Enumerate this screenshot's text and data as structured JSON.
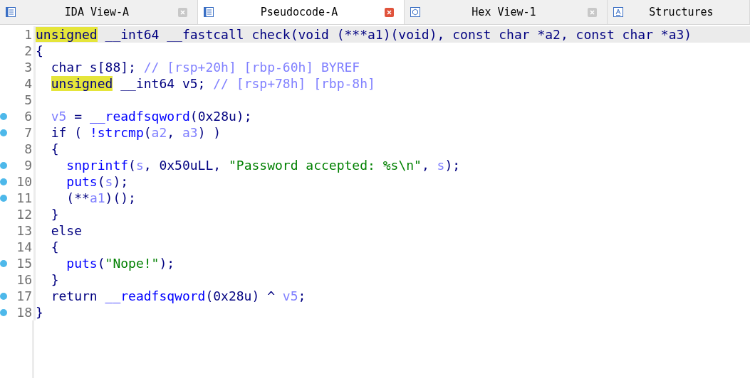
{
  "tabs": [
    {
      "label": "IDA View-A",
      "selected": false,
      "closable": true
    },
    {
      "label": "Pseudocode-A",
      "selected": true,
      "closable": true
    },
    {
      "label": "Hex View-1",
      "selected": false,
      "closable": true
    },
    {
      "label": "Structures",
      "selected": false,
      "closable": false
    }
  ],
  "code": [
    {
      "number": "1",
      "dot": false,
      "current": true,
      "tokens": [
        {
          "kind": "hl",
          "text": "unsigned"
        },
        {
          "kind": "text",
          "text": " __int64 __fastcall check(void (***a1)(void), const char *a2, const char *a3)"
        }
      ]
    },
    {
      "number": "2",
      "dot": false,
      "current": false,
      "tokens": [
        {
          "kind": "text",
          "text": "{"
        }
      ]
    },
    {
      "number": "3",
      "dot": false,
      "current": false,
      "tokens": [
        {
          "kind": "text",
          "text": "  char s[88]; "
        },
        {
          "kind": "comment",
          "text": "// [rsp+20h] [rbp-60h] BYREF"
        }
      ]
    },
    {
      "number": "4",
      "dot": false,
      "current": false,
      "tokens": [
        {
          "kind": "hl",
          "text": "  unsigned"
        },
        {
          "kind": "text",
          "text": " __int64 v5; "
        },
        {
          "kind": "comment",
          "text": "// [rsp+78h] [rbp-8h]"
        }
      ]
    },
    {
      "number": "5",
      "dot": false,
      "current": false
    },
    {
      "number": "6",
      "dot": true,
      "current": false,
      "tokens": [
        {
          "kind": "var",
          "text": "  v5"
        },
        {
          "kind": "text",
          "text": " = "
        },
        {
          "kind": "func",
          "text": "__readfsqword"
        },
        {
          "kind": "text",
          "text": "(0x28u);"
        }
      ]
    },
    {
      "number": "7",
      "dot": true,
      "current": false,
      "tokens": [
        {
          "kind": "text",
          "text": "  if ( "
        },
        {
          "kind": "func",
          "text": "!strcmp"
        },
        {
          "kind": "text",
          "text": "("
        },
        {
          "kind": "var",
          "text": "a2"
        },
        {
          "kind": "text",
          "text": ", "
        },
        {
          "kind": "var",
          "text": "a3"
        },
        {
          "kind": "text",
          "text": ") )"
        }
      ]
    },
    {
      "number": "8",
      "dot": false,
      "current": false,
      "tokens": [
        {
          "kind": "text",
          "text": "  {"
        }
      ]
    },
    {
      "number": "9",
      "dot": true,
      "current": false,
      "tokens": [
        {
          "kind": "func",
          "text": "    snprintf"
        },
        {
          "kind": "text",
          "text": "("
        },
        {
          "kind": "var",
          "text": "s"
        },
        {
          "kind": "text",
          "text": ", 0x50uLL, "
        },
        {
          "kind": "string",
          "text": "\"Password accepted: %s\\n\""
        },
        {
          "kind": "text",
          "text": ", "
        },
        {
          "kind": "var",
          "text": "s"
        },
        {
          "kind": "text",
          "text": ");"
        }
      ]
    },
    {
      "number": "10",
      "dot": true,
      "current": false,
      "tokens": [
        {
          "kind": "func",
          "text": "    puts"
        },
        {
          "kind": "text",
          "text": "("
        },
        {
          "kind": "var",
          "text": "s"
        },
        {
          "kind": "text",
          "text": ");"
        }
      ]
    },
    {
      "number": "11",
      "dot": true,
      "current": false,
      "tokens": [
        {
          "kind": "text",
          "text": "    (**"
        },
        {
          "kind": "var",
          "text": "a1"
        },
        {
          "kind": "text",
          "text": ")();"
        }
      ]
    },
    {
      "number": "12",
      "dot": false,
      "current": false,
      "tokens": [
        {
          "kind": "text",
          "text": "  }"
        }
      ]
    },
    {
      "number": "13",
      "dot": false,
      "current": false,
      "tokens": [
        {
          "kind": "text",
          "text": "  else"
        }
      ]
    },
    {
      "number": "14",
      "dot": false,
      "current": false,
      "tokens": [
        {
          "kind": "text",
          "text": "  {"
        }
      ]
    },
    {
      "number": "15",
      "dot": true,
      "current": false,
      "tokens": [
        {
          "kind": "func",
          "text": "    puts"
        },
        {
          "kind": "text",
          "text": "("
        },
        {
          "kind": "string",
          "text": "\"Nope!\""
        },
        {
          "kind": "text",
          "text": ");"
        }
      ]
    },
    {
      "number": "16",
      "dot": false,
      "current": false,
      "tokens": [
        {
          "kind": "text",
          "text": "  }"
        }
      ]
    },
    {
      "number": "17",
      "dot": true,
      "current": false,
      "tokens": [
        {
          "kind": "text",
          "text": "  return "
        },
        {
          "kind": "func",
          "text": "__readfsqword"
        },
        {
          "kind": "text",
          "text": "(0x28u) ^ "
        },
        {
          "kind": "var",
          "text": "v5"
        },
        {
          "kind": "text",
          "text": ";"
        }
      ]
    },
    {
      "number": "18",
      "dot": true,
      "current": false,
      "tokens": [
        {
          "kind": "text",
          "text": "}"
        }
      ]
    }
  ]
}
